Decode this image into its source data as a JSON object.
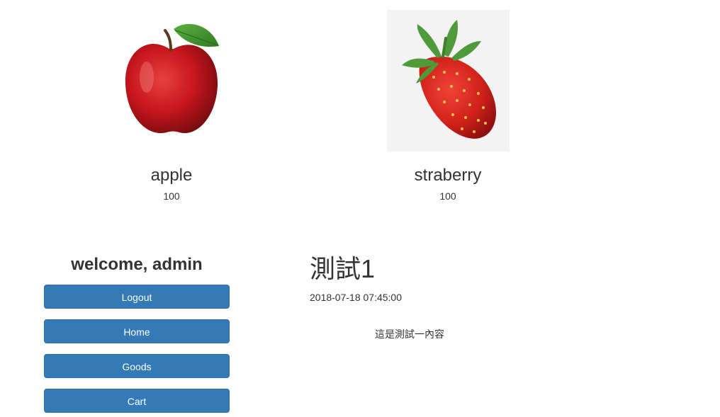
{
  "products": [
    {
      "name": "apple",
      "price": "100",
      "image_icon": "apple-image"
    },
    {
      "name": "straberry",
      "price": "100",
      "image_icon": "strawberry-image"
    }
  ],
  "sidebar": {
    "welcome": "welcome, admin",
    "buttons": {
      "logout": "Logout",
      "home": "Home",
      "goods": "Goods",
      "cart": "Cart"
    }
  },
  "article": {
    "title": "測試1",
    "date": "2018-07-18 07:45:00",
    "content": "這是測試一內容"
  },
  "colors": {
    "button_bg": "#337ab7",
    "button_border": "#2e6da4",
    "text": "#333333"
  }
}
